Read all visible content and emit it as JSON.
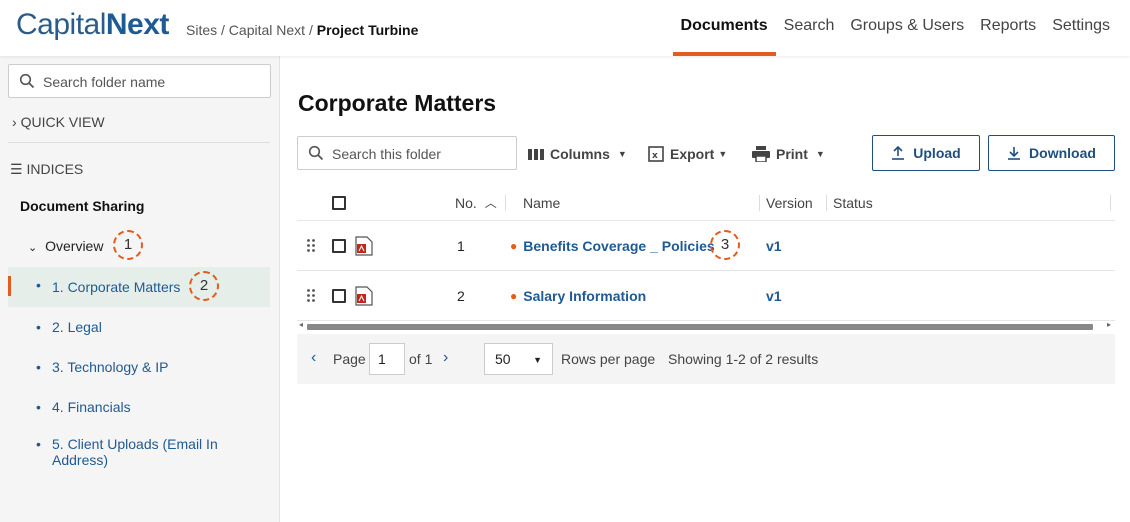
{
  "header": {
    "logo_light": "Capital",
    "logo_bold": "Next",
    "breadcrumb": {
      "sites": "Sites",
      "sep1": " / ",
      "site": "Capital Next",
      "sep2": " / ",
      "current": "Project Turbine"
    },
    "nav": [
      "Documents",
      "Search",
      "Groups & Users",
      "Reports",
      "Settings"
    ],
    "nav_active": "Documents",
    "accent_color": "#e35b1e"
  },
  "sidebar": {
    "search_placeholder": "Search folder name",
    "quick_view": "QUICK VIEW",
    "indices": "INDICES",
    "section_title": "Document Sharing",
    "overview": "Overview",
    "items": [
      {
        "label": "1. Corporate Matters",
        "selected": true
      },
      {
        "label": "2. Legal"
      },
      {
        "label": "3. Technology & IP"
      },
      {
        "label": "4. Financials"
      },
      {
        "label": "5. Client Uploads (Email In Address)"
      }
    ]
  },
  "callouts": [
    "1",
    "2",
    "3"
  ],
  "main": {
    "title": "Corporate Matters",
    "search_placeholder": "Search this folder",
    "toolbar": {
      "columns": "Columns",
      "export": "Export",
      "print": "Print",
      "upload": "Upload",
      "download": "Download"
    },
    "table": {
      "headers": {
        "no": "No.",
        "name": "Name",
        "version": "Version",
        "status": "Status"
      },
      "rows": [
        {
          "no": "1",
          "name": "Benefits Coverage _ Policies",
          "version": "v1",
          "status": ""
        },
        {
          "no": "2",
          "name": "Salary Information",
          "version": "v1",
          "status": ""
        }
      ]
    },
    "pagination": {
      "page_label": "Page",
      "page_value": "1",
      "of_label": "of 1",
      "rows_value": "50",
      "rows_label": "Rows per page",
      "showing": "Showing 1-2 of 2 results"
    }
  }
}
